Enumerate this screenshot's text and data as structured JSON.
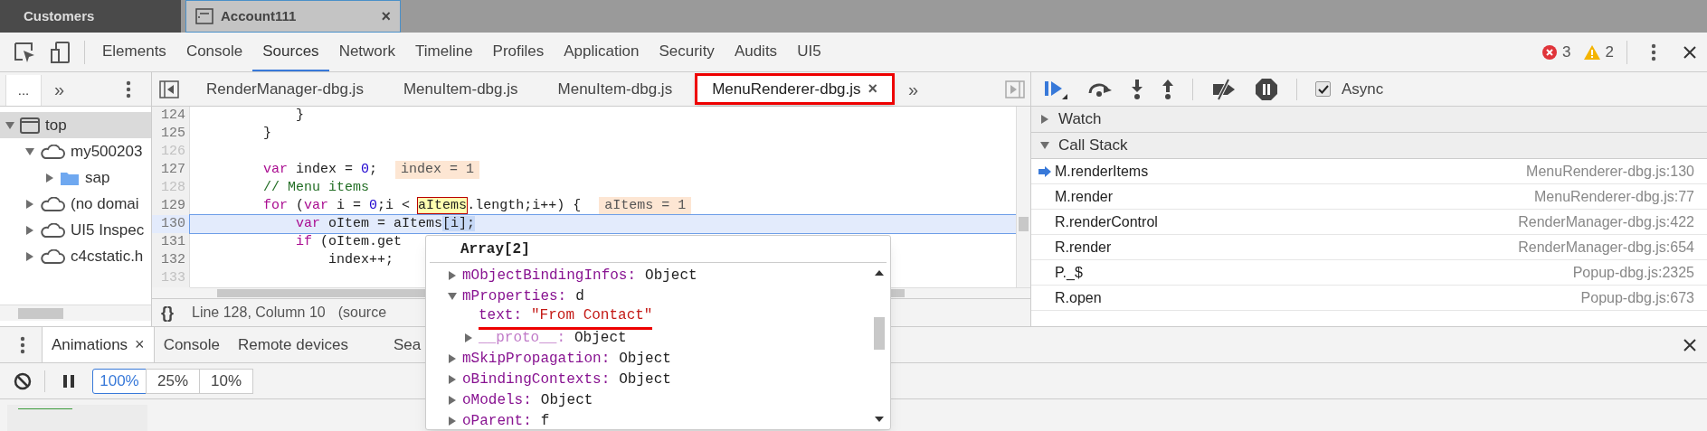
{
  "browser_tabs": [
    {
      "label": "Customers",
      "selected": false
    },
    {
      "label": "Account111",
      "selected": true,
      "close_glyph": "×"
    }
  ],
  "devtools_tabs": [
    {
      "label": "Elements",
      "selected": false
    },
    {
      "label": "Console",
      "selected": false
    },
    {
      "label": "Sources",
      "selected": true
    },
    {
      "label": "Network",
      "selected": false
    },
    {
      "label": "Timeline",
      "selected": false
    },
    {
      "label": "Profiles",
      "selected": false
    },
    {
      "label": "Application",
      "selected": false
    },
    {
      "label": "Security",
      "selected": false
    },
    {
      "label": "Audits",
      "selected": false
    },
    {
      "label": "UI5",
      "selected": false
    }
  ],
  "error_count": "3",
  "warning_count": "2",
  "navigator": {
    "tab": "...",
    "more_glyph": "»",
    "tree": [
      {
        "label": "top",
        "kind": "frame",
        "expanded": true,
        "selected": true,
        "children": [
          {
            "label": "my500203",
            "kind": "domain",
            "expanded": true,
            "selected": false,
            "children": [
              {
                "label": "sap",
                "kind": "folder",
                "expanded": false,
                "selected": false
              }
            ]
          },
          {
            "label": "(no domai",
            "kind": "domain",
            "expanded": false,
            "selected": false
          },
          {
            "label": "UI5 Inspec",
            "kind": "domain",
            "expanded": false,
            "selected": false
          },
          {
            "label": "c4cstatic.h",
            "kind": "domain",
            "expanded": false,
            "selected": false
          }
        ]
      }
    ]
  },
  "editor_tabs": [
    {
      "label": "RenderManager-dbg.js",
      "selected": false,
      "highlighted": false
    },
    {
      "label": "MenuItem-dbg.js",
      "selected": false,
      "highlighted": false
    },
    {
      "label": "MenuItem-dbg.js",
      "selected": false,
      "highlighted": false
    },
    {
      "label": "MenuRenderer-dbg.js",
      "selected": true,
      "highlighted": true,
      "close_glyph": "×"
    }
  ],
  "editor_more_glyph": "»",
  "code_lines": [
    {
      "number": "124",
      "breakable": true,
      "current": false,
      "segments": [
        {
          "text": "            }",
          "kind": "plain"
        }
      ]
    },
    {
      "number": "125",
      "breakable": true,
      "current": false,
      "segments": [
        {
          "text": "        }",
          "kind": "plain"
        }
      ]
    },
    {
      "number": "126",
      "breakable": false,
      "current": false
    },
    {
      "number": "127",
      "breakable": true,
      "current": false,
      "segments": [
        {
          "text": "        var",
          "kind": "keyword"
        },
        {
          "text": " index = ",
          "kind": "plain"
        },
        {
          "text": "0",
          "kind": "number"
        },
        {
          "text": ";",
          "kind": "plain"
        }
      ],
      "inline_value": "index = 1"
    },
    {
      "number": "128",
      "breakable": false,
      "current": false,
      "segments": [
        {
          "text": "        // Menu items",
          "kind": "comment"
        }
      ]
    },
    {
      "number": "129",
      "breakable": true,
      "current": false,
      "segments": [
        {
          "text": "        for",
          "kind": "keyword"
        },
        {
          "text": " (",
          "kind": "plain"
        },
        {
          "text": "var",
          "kind": "keyword"
        },
        {
          "text": " i = ",
          "kind": "plain"
        },
        {
          "text": "0",
          "kind": "number"
        },
        {
          "text": ";i < ",
          "kind": "plain"
        },
        {
          "text": "aItems",
          "kind": "hovered"
        },
        {
          "text": ".length;i++) {",
          "kind": "plain"
        }
      ],
      "inline_value": "aItems = 1"
    },
    {
      "number": "130",
      "breakable": true,
      "current": true,
      "segments": [
        {
          "text": "            var",
          "kind": "keyword"
        },
        {
          "text": " oItem = aItems",
          "kind": "plain"
        },
        {
          "text": "[i];",
          "kind": "selection"
        }
      ]
    },
    {
      "number": "131",
      "breakable": true,
      "current": false,
      "segments": [
        {
          "text": "            if",
          "kind": "keyword"
        },
        {
          "text": " (oItem.get",
          "kind": "plain"
        }
      ]
    },
    {
      "number": "132",
      "breakable": true,
      "current": false,
      "segments": [
        {
          "text": "                index++;",
          "kind": "plain"
        }
      ]
    },
    {
      "number": "133",
      "breakable": false,
      "current": false
    }
  ],
  "status": {
    "format_glyph": "{}",
    "position": "Line 128, Column 10",
    "source": "(source"
  },
  "async": {
    "label": "Async",
    "checked": true
  },
  "sections": [
    {
      "title": "Watch",
      "expanded": false
    },
    {
      "title": "Call Stack",
      "expanded": true
    }
  ],
  "call_stack": [
    {
      "name": "M.renderItems",
      "location": "MenuRenderer-dbg.js:130",
      "selected": true
    },
    {
      "name": "M.render",
      "location": "MenuRenderer-dbg.js:77",
      "selected": false
    },
    {
      "name": "R.renderControl",
      "location": "RenderManager-dbg.js:422",
      "selected": false
    },
    {
      "name": "R.render",
      "location": "RenderManager-dbg.js:654",
      "selected": false
    },
    {
      "name": "P._$",
      "location": "Popup-dbg.js:2325",
      "selected": false
    },
    {
      "name": "R.open",
      "location": "Popup-dbg.js:673",
      "selected": false
    }
  ],
  "drawer_tabs": [
    {
      "label": "Animations",
      "selected": true,
      "close_glyph": "×"
    },
    {
      "label": "Console",
      "selected": false
    },
    {
      "label": "Remote devices",
      "selected": false
    },
    {
      "label": "Sea",
      "selected": false
    }
  ],
  "playback_rates": [
    {
      "label": "100%",
      "selected": true
    },
    {
      "label": "25%",
      "selected": false
    },
    {
      "label": "10%",
      "selected": false
    }
  ],
  "popover": {
    "title": "Array[2]",
    "rows": [
      {
        "key": "mObjectBindingInfos:",
        "value": "Object",
        "kind": "own",
        "expanded": false,
        "underlined": false
      },
      {
        "key": "mProperties:",
        "value": "d",
        "kind": "own",
        "expanded": true,
        "underlined": false,
        "children": [
          {
            "key": "text:",
            "value": "\"From Contact\"",
            "kind": "string",
            "underlined": true
          },
          {
            "key": "__proto__:",
            "value": "Object",
            "kind": "internal",
            "expanded": false,
            "underlined": false
          }
        ]
      },
      {
        "key": "mSkipPropagation:",
        "value": "Object",
        "kind": "own",
        "expanded": false,
        "underlined": false
      },
      {
        "key": "oBindingContexts:",
        "value": "Object",
        "kind": "own",
        "expanded": false,
        "underlined": false
      },
      {
        "key": "oModels:",
        "value": "Object",
        "kind": "own",
        "expanded": false,
        "underlined": false
      },
      {
        "key": "oParent:",
        "value": "f",
        "kind": "own",
        "expanded": false,
        "underlined": false
      }
    ]
  }
}
